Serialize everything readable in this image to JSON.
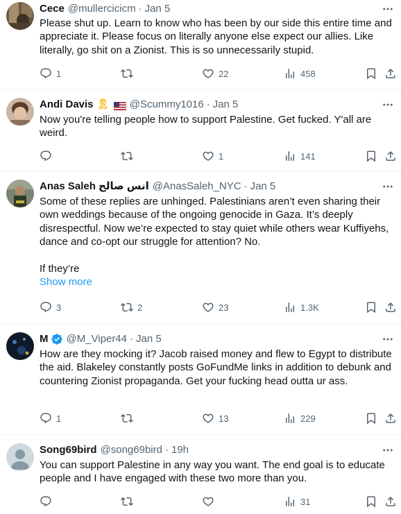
{
  "tweets": [
    {
      "name": "Cece",
      "handle": "@mullercicicm",
      "time": "Jan 5",
      "text": "Please shut up. Learn to know who has been by our side this entire time and appreciate it. Please focus on literally anyone else expect our allies. Like literally, go shit on a Zionist. This is so unnecessarily stupid.",
      "replies": "1",
      "retweets": "",
      "likes": "22",
      "views": "458"
    },
    {
      "name": "Andi Davis",
      "badge_emoji": "🎗",
      "handle": "@Scummy1016",
      "time": "Jan 5",
      "text": "Now you're telling people how to support Palestine. Get fucked. Y'all are weird.",
      "replies": "",
      "retweets": "",
      "likes": "1",
      "views": "141"
    },
    {
      "name": "Anas Saleh انس صالح",
      "handle": "@AnasSaleh_NYC",
      "time": "Jan 5",
      "text": "Some of these replies are unhinged. Palestinians aren’t even sharing their own weddings because of the ongoing genocide in Gaza. It’s deeply disrespectful. Now we’re expected to stay quiet while others wear Kuffiyehs, dance and co-opt our struggle for attention? No.",
      "text2": "If they’re",
      "show_more": "Show more",
      "replies": "3",
      "retweets": "2",
      "likes": "23",
      "views": "1.3K"
    },
    {
      "name": "M",
      "handle": "@M_Viper44",
      "time": "Jan 5",
      "text": "How are they mocking it? Jacob raised money and flew to Egypt to distribute the aid. Blakeley constantly posts GoFundMe links in addition to debunk and countering Zionist propaganda. Get your fucking head outta ur ass.",
      "replies": "1",
      "retweets": "",
      "likes": "13",
      "views": "229"
    },
    {
      "name": "Song69bird",
      "handle": "@song69bird",
      "time": "19h",
      "text": "You can support Palestine in any way you want. The end goal is to educate people and I have engaged with these two more than you.",
      "replies": "",
      "retweets": "",
      "likes": "",
      "views": "31"
    }
  ],
  "separator": "·",
  "icons": {
    "reply": "reply-icon",
    "retweet": "retweet-icon",
    "like": "like-icon",
    "views": "views-icon",
    "bookmark": "bookmark-icon",
    "share": "share-icon",
    "more": "more-icon",
    "verified": "verified-badge-icon",
    "flag": "us-flag-icon"
  },
  "colors": {
    "text": "#0f1419",
    "secondary": "#536471",
    "link": "#1d9bf0",
    "verified": "#1d9bf0",
    "divider": "#eff3f4"
  }
}
